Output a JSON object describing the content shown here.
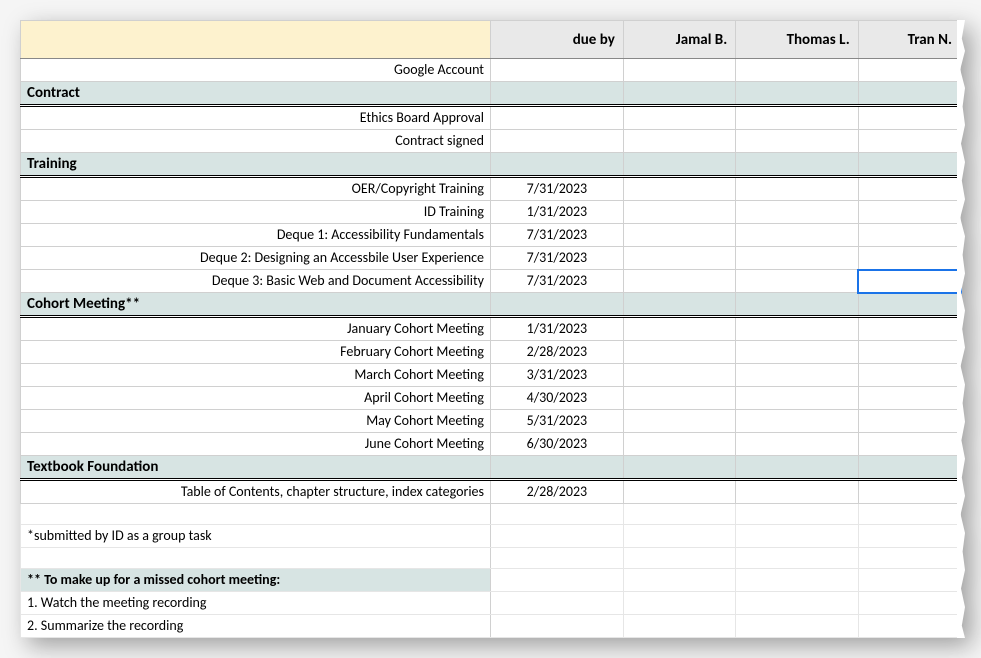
{
  "columns": {
    "task": "",
    "due": "due by",
    "p1": "Jamal B.",
    "p2": "Thomas L.",
    "p3": "Tran N."
  },
  "preRows": [
    {
      "task": "Google Account",
      "due": ""
    }
  ],
  "sections": [
    {
      "name": "Contract",
      "rows": [
        {
          "task": "Ethics Board Approval",
          "due": ""
        },
        {
          "task": "Contract signed",
          "due": ""
        }
      ]
    },
    {
      "name": "Training",
      "rows": [
        {
          "task": "OER/Copyright Training",
          "due": "7/31/2023"
        },
        {
          "task": "ID Training",
          "due": "1/31/2023"
        },
        {
          "task": "Deque 1: Accessibility Fundamentals",
          "due": "7/31/2023"
        },
        {
          "task": "Deque 2: Designing an Accessbile User Experience",
          "due": "7/31/2023"
        },
        {
          "task": "Deque 3:  Basic Web and Document Accessibility",
          "due": "7/31/2023",
          "activeP3": true
        }
      ]
    },
    {
      "name": "Cohort Meeting**",
      "rows": [
        {
          "task": "January Cohort Meeting",
          "due": "1/31/2023"
        },
        {
          "task": "February Cohort Meeting",
          "due": "2/28/2023"
        },
        {
          "task": "March Cohort Meeting",
          "due": "3/31/2023"
        },
        {
          "task": "April Cohort Meeting",
          "due": "4/30/2023"
        },
        {
          "task": "May Cohort Meeting",
          "due": "5/31/2023"
        },
        {
          "task": "June Cohort Meeting",
          "due": "6/30/2023"
        }
      ]
    },
    {
      "name": "Textbook Foundation",
      "rows": [
        {
          "task": "Table of Contents, chapter structure, index categories",
          "due": "2/28/2023"
        }
      ]
    }
  ],
  "notes": {
    "n1": "*submitted by ID as a group task",
    "makeupHeader": "** To make up for a missed cohort meeting:",
    "m1": "1. Watch the meeting recording",
    "m2": "2. Summarize the recording"
  }
}
